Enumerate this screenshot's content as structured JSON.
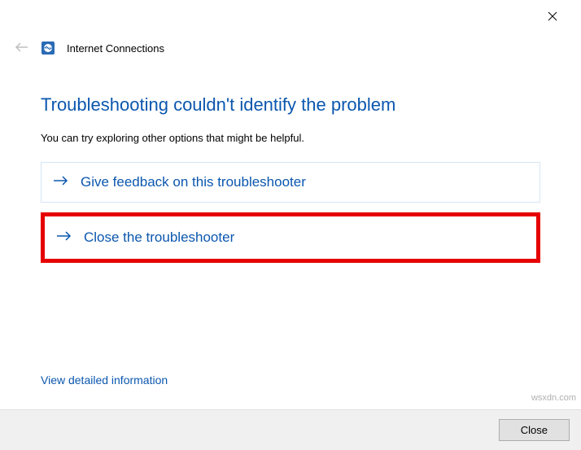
{
  "window": {
    "title": "Internet Connections"
  },
  "main": {
    "heading": "Troubleshooting couldn't identify the problem",
    "subtext": "You can try exploring other options that might be helpful."
  },
  "options": {
    "feedback": "Give feedback on this troubleshooter",
    "close": "Close the troubleshooter"
  },
  "links": {
    "detail": "View detailed information"
  },
  "buttons": {
    "close": "Close"
  },
  "watermark": "wsxdn.com"
}
